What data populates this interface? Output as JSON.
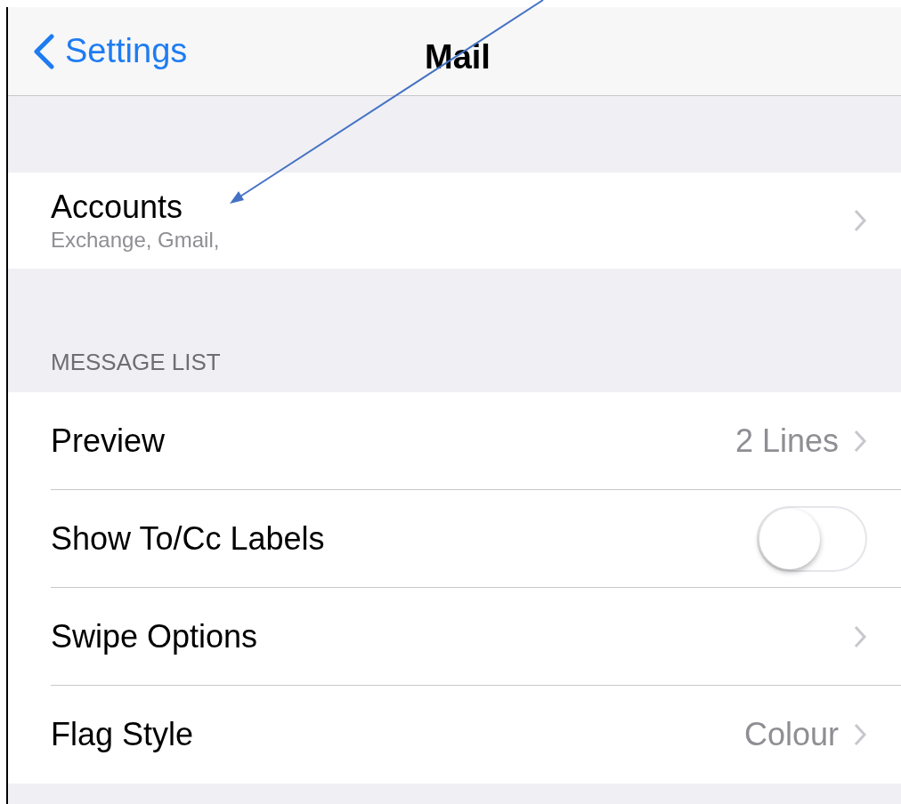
{
  "nav": {
    "back": "Settings",
    "title": "Mail"
  },
  "accounts": {
    "label": "Accounts",
    "subtitle": "Exchange, Gmail,"
  },
  "section": {
    "header": "MESSAGE LIST",
    "rows": [
      {
        "kind": "link",
        "label": "Preview",
        "value": "2 Lines"
      },
      {
        "kind": "toggle",
        "label": "Show To/Cc Labels",
        "on": false
      },
      {
        "kind": "link",
        "label": "Swipe Options"
      },
      {
        "kind": "link",
        "label": "Flag Style",
        "value": "Colour"
      }
    ]
  }
}
